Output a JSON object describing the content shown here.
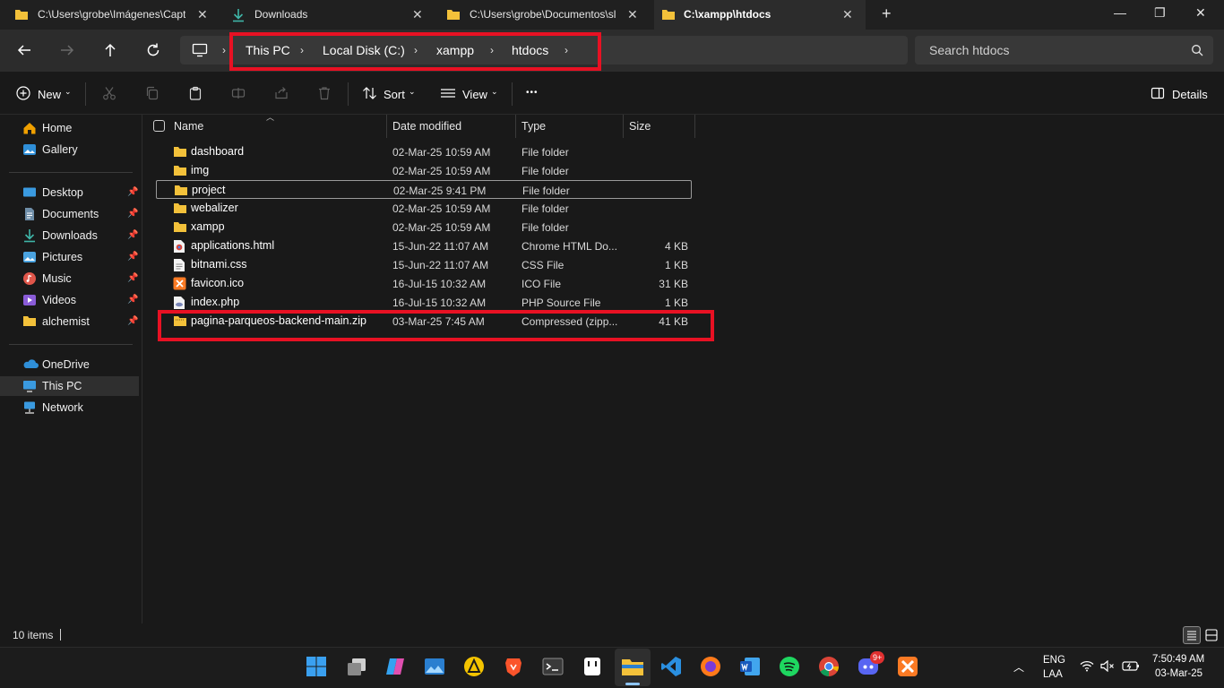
{
  "tabs": [
    {
      "label": "C:\\Users\\grobe\\Imágenes\\Capt",
      "icon": "folder-icon"
    },
    {
      "label": "Downloads",
      "icon": "download-icon"
    },
    {
      "label": "C:\\Users\\grobe\\Documentos\\sl",
      "icon": "folder-icon"
    },
    {
      "label": "C:\\xampp\\htdocs",
      "icon": "folder-icon",
      "active": true
    }
  ],
  "new_tab_label": "+",
  "window_controls": {
    "minimize": "—",
    "maximize": "❐",
    "close": "✕"
  },
  "breadcrumb": [
    "This PC",
    "Local Disk (C:)",
    "xampp",
    "htdocs"
  ],
  "search": {
    "placeholder": "Search htdocs"
  },
  "toolbar": {
    "new": "New",
    "sort": "Sort",
    "view": "View",
    "more": "•••",
    "details": "Details"
  },
  "sidebar": {
    "top": [
      {
        "label": "Home"
      },
      {
        "label": "Gallery"
      }
    ],
    "pinned": [
      {
        "label": "Desktop"
      },
      {
        "label": "Documents"
      },
      {
        "label": "Downloads"
      },
      {
        "label": "Pictures"
      },
      {
        "label": "Music"
      },
      {
        "label": "Videos"
      },
      {
        "label": "alchemist"
      }
    ],
    "bottom": [
      {
        "label": "OneDrive"
      },
      {
        "label": "This PC",
        "selected": true
      },
      {
        "label": "Network"
      }
    ]
  },
  "columns": {
    "name": "Name",
    "date": "Date modified",
    "type": "Type",
    "size": "Size"
  },
  "files": [
    {
      "name": "dashboard",
      "date": "02-Mar-25 10:59 AM",
      "type": "File folder",
      "size": "",
      "icon": "folder-icon"
    },
    {
      "name": "img",
      "date": "02-Mar-25 10:59 AM",
      "type": "File folder",
      "size": "",
      "icon": "folder-icon"
    },
    {
      "name": "project",
      "date": "02-Mar-25 9:41 PM",
      "type": "File folder",
      "size": "",
      "icon": "folder-icon"
    },
    {
      "name": "webalizer",
      "date": "02-Mar-25 10:59 AM",
      "type": "File folder",
      "size": "",
      "icon": "folder-icon"
    },
    {
      "name": "xampp",
      "date": "02-Mar-25 10:59 AM",
      "type": "File folder",
      "size": "",
      "icon": "folder-icon"
    },
    {
      "name": "applications.html",
      "date": "15-Jun-22 11:07 AM",
      "type": "Chrome HTML Do...",
      "size": "4 KB",
      "icon": "chrome-html-icon"
    },
    {
      "name": "bitnami.css",
      "date": "15-Jun-22 11:07 AM",
      "type": "CSS File",
      "size": "1 KB",
      "icon": "file-icon"
    },
    {
      "name": "favicon.ico",
      "date": "16-Jul-15 10:32 AM",
      "type": "ICO File",
      "size": "31 KB",
      "icon": "xampp-icon"
    },
    {
      "name": "index.php",
      "date": "16-Jul-15 10:32 AM",
      "type": "PHP Source File",
      "size": "1 KB",
      "icon": "php-file-icon"
    },
    {
      "name": "pagina-parqueos-backend-main.zip",
      "date": "03-Mar-25 7:45 AM",
      "type": "Compressed (zipp...",
      "size": "41 KB",
      "icon": "zip-folder-icon"
    }
  ],
  "status": {
    "count": "10 items"
  },
  "taskbar": {
    "apps": [
      "windows-start-icon",
      "task-view-icon",
      "copilot-icon",
      "photos-icon",
      "autocad-icon",
      "brave-icon",
      "terminal-icon",
      "notepad-icon",
      "file-explorer-icon",
      "vscode-icon",
      "firefox-icon",
      "word-icon",
      "spotify-icon",
      "chrome-icon",
      "discord-icon",
      "xampp-icon"
    ],
    "discord_badge": "9+",
    "lang_top": "ENG",
    "lang_bottom": "LAA",
    "time": "7:50:49 AM",
    "date": "03-Mar-25"
  },
  "colors": {
    "accent": "#e81123",
    "folder": "#f3c13a",
    "background": "#191919"
  }
}
